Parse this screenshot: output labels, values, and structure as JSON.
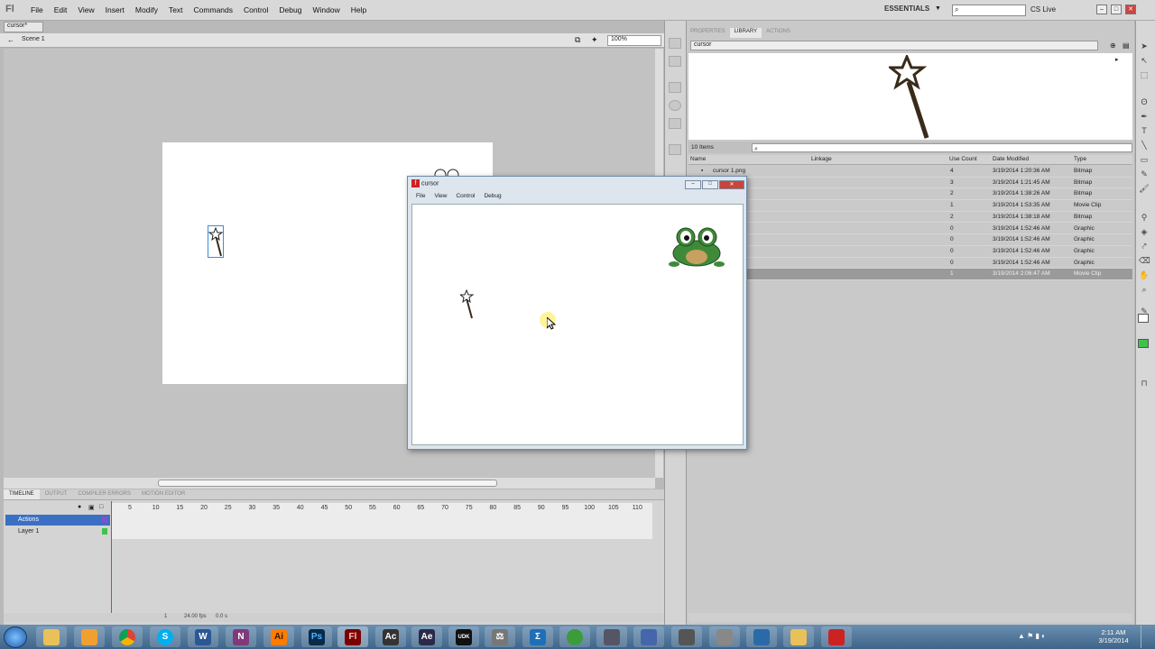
{
  "app": {
    "logo": "Fl"
  },
  "menu": [
    "File",
    "Edit",
    "View",
    "Insert",
    "Modify",
    "Text",
    "Commands",
    "Control",
    "Debug",
    "Window",
    "Help"
  ],
  "workspace": "ESSENTIALS",
  "cs_live": "CS Live",
  "document_tab": "cursor*",
  "scene": "Scene 1",
  "zoom": "100%",
  "timeline": {
    "tabs": [
      "TIMELINE",
      "OUTPUT",
      "COMPILER ERRORS",
      "MOTION EDITOR"
    ],
    "frame_numbers": [
      "5",
      "10",
      "15",
      "20",
      "25",
      "30",
      "35",
      "40",
      "45",
      "50",
      "55",
      "60",
      "65",
      "70",
      "75",
      "80",
      "85",
      "90",
      "95",
      "100",
      "105",
      "110"
    ],
    "layers": [
      "Actions",
      "Layer 1"
    ],
    "footer": {
      "frame": "1",
      "fps": "24.00 fps",
      "time": "0.0 s"
    }
  },
  "right_panel": {
    "tabs": [
      "PROPERTIES",
      "LIBRARY",
      "ACTIONS"
    ],
    "library_name": "cursor",
    "item_count": "10 Items",
    "columns": [
      "Name",
      "Linkage",
      "Use Count",
      "Date Modified",
      "Type"
    ],
    "rows": [
      {
        "name": "cursor 1.png",
        "count": "4",
        "date": "3/19/2014 1:20:36 AM",
        "type": "Bitmap"
      },
      {
        "name": "",
        "count": "3",
        "date": "3/19/2014 1:21:45 AM",
        "type": "Bitmap"
      },
      {
        "name": "",
        "count": "2",
        "date": "3/19/2014 1:38:26 AM",
        "type": "Bitmap"
      },
      {
        "name": "",
        "count": "1",
        "date": "3/19/2014 1:53:35 AM",
        "type": "Movie Clip"
      },
      {
        "name": "",
        "count": "2",
        "date": "3/19/2014 1:38:18 AM",
        "type": "Bitmap"
      },
      {
        "name": "",
        "count": "0",
        "date": "3/19/2014 1:52:46 AM",
        "type": "Graphic"
      },
      {
        "name": "",
        "count": "0",
        "date": "3/19/2014 1:52:46 AM",
        "type": "Graphic"
      },
      {
        "name": "",
        "count": "0",
        "date": "3/19/2014 1:52:46 AM",
        "type": "Graphic"
      },
      {
        "name": "",
        "count": "0",
        "date": "3/19/2014 1:52:46 AM",
        "type": "Graphic"
      },
      {
        "name": "",
        "count": "1",
        "date": "3/19/2014 2:06:47 AM",
        "type": "Movie Clip"
      }
    ]
  },
  "swf_window": {
    "title": "cursor",
    "menu": [
      "File",
      "View",
      "Control",
      "Debug"
    ]
  },
  "taskbar": {
    "icons": [
      "S",
      "W",
      "N",
      "Ai",
      "Ps",
      "Fl",
      "Ac",
      "Ae",
      "UDK",
      "⚖",
      "Σ"
    ],
    "time": "2:11 AM",
    "date": "3/19/2014"
  },
  "colors": {
    "frog": "#3f8a3a",
    "wand": "#3a2a1a",
    "accent": "#2b6fc2",
    "selected_row": "#9a9a9a"
  }
}
